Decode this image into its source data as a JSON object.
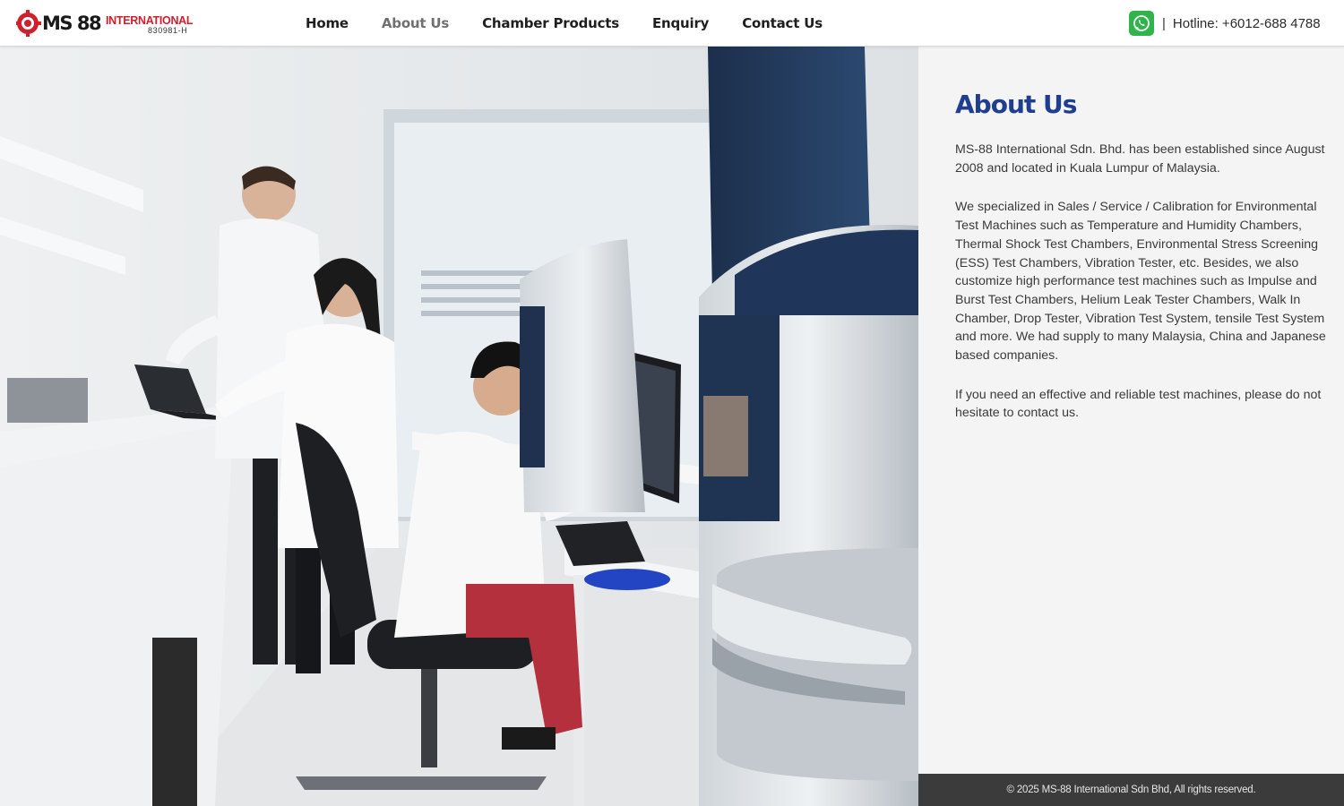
{
  "brand": {
    "logo_text": "MS 88",
    "logo_subtext": "INTERNATIONAL",
    "logo_reg": "830981-H",
    "logo_color": "#d0202e"
  },
  "nav": {
    "items": [
      {
        "label": "Home",
        "active": false
      },
      {
        "label": "About Us",
        "active": true
      },
      {
        "label": "Chamber Products",
        "active": false
      },
      {
        "label": "Enquiry",
        "active": false
      },
      {
        "label": "Contact Us",
        "active": false
      }
    ]
  },
  "contact": {
    "icon": "whatsapp-icon",
    "separator": "|",
    "hotline": "Hotline: +6012-688 4788"
  },
  "photo": {
    "icon": "lab-photo"
  },
  "about": {
    "title": "About Us",
    "paragraphs": [
      "MS-88 International Sdn. Bhd. has been established since August 2008 and located in Kuala Lumpur of Malaysia.",
      "We specialized in Sales / Service / Calibration for Environmental Test Machines such as Temperature and Humidity Chambers, Thermal Shock Test Chambers, Environmental Stress Screening (ESS) Test Chambers, Vibration Tester, etc. Besides, we also customize high performance test machines such as Impulse and Burst Test Chambers, Helium Leak Tester Chambers, Walk In Chamber, Drop Tester, Vibration Test System, tensile Test System and more. We had supply to many Malaysia, China and Japanese based companies.",
      "If you need an effective and reliable test machines, please do not hesitate to contact us."
    ]
  },
  "footer": {
    "copyright": "© 2025 MS-88 International Sdn Bhd, All rights reserved."
  },
  "colors": {
    "accent_title": "#1f3e8f",
    "whatsapp": "#2fb34a",
    "footer_bg": "#3b3b3b",
    "panel_bg": "#f4f4f4"
  }
}
